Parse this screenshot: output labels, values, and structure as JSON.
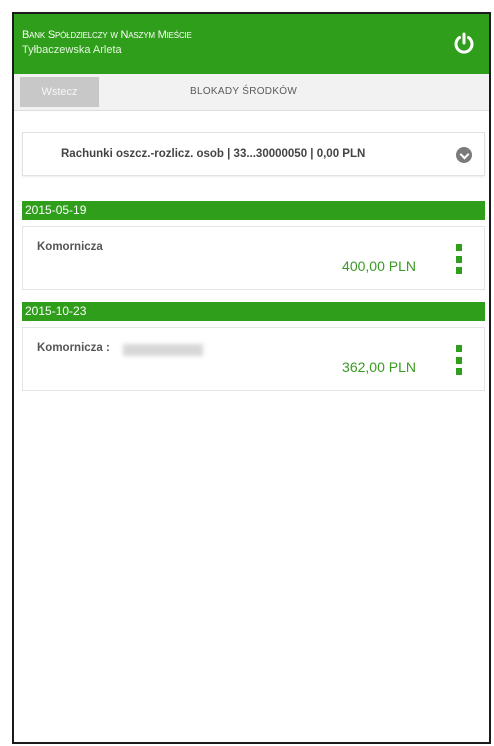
{
  "header": {
    "bank_name": "Bank Spółdzielczy w Naszym Mieście",
    "user_name": "Tyłbaczewska Arleta"
  },
  "nav": {
    "back_label": "Wstecz",
    "title": "Blokady środków"
  },
  "account_selector": {
    "value": "Rachunki oszcz.-rozlicz. osob | 33...30000050 | 0,00 PLN"
  },
  "blocks": [
    {
      "date": "2015-05-19",
      "title": "Komornicza",
      "amount": "400,00 PLN"
    },
    {
      "date": "2015-10-23",
      "title": "Komornicza :",
      "amount": "362,00 PLN"
    }
  ],
  "colors": {
    "accent": "#2f9e1b",
    "amount": "#3a9a22"
  },
  "icons": {
    "logout": "power-icon",
    "dropdown": "chevron-down-icon",
    "more": "more-vertical-icon"
  }
}
